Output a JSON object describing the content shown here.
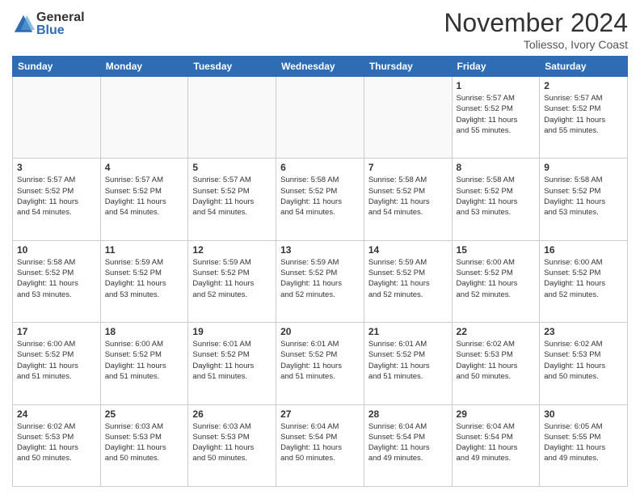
{
  "logo": {
    "general": "General",
    "blue": "Blue"
  },
  "header": {
    "month": "November 2024",
    "location": "Toliesso, Ivory Coast"
  },
  "weekdays": [
    "Sunday",
    "Monday",
    "Tuesday",
    "Wednesday",
    "Thursday",
    "Friday",
    "Saturday"
  ],
  "weeks": [
    [
      {
        "day": "",
        "info": ""
      },
      {
        "day": "",
        "info": ""
      },
      {
        "day": "",
        "info": ""
      },
      {
        "day": "",
        "info": ""
      },
      {
        "day": "",
        "info": ""
      },
      {
        "day": "1",
        "info": "Sunrise: 5:57 AM\nSunset: 5:52 PM\nDaylight: 11 hours\nand 55 minutes."
      },
      {
        "day": "2",
        "info": "Sunrise: 5:57 AM\nSunset: 5:52 PM\nDaylight: 11 hours\nand 55 minutes."
      }
    ],
    [
      {
        "day": "3",
        "info": "Sunrise: 5:57 AM\nSunset: 5:52 PM\nDaylight: 11 hours\nand 54 minutes."
      },
      {
        "day": "4",
        "info": "Sunrise: 5:57 AM\nSunset: 5:52 PM\nDaylight: 11 hours\nand 54 minutes."
      },
      {
        "day": "5",
        "info": "Sunrise: 5:57 AM\nSunset: 5:52 PM\nDaylight: 11 hours\nand 54 minutes."
      },
      {
        "day": "6",
        "info": "Sunrise: 5:58 AM\nSunset: 5:52 PM\nDaylight: 11 hours\nand 54 minutes."
      },
      {
        "day": "7",
        "info": "Sunrise: 5:58 AM\nSunset: 5:52 PM\nDaylight: 11 hours\nand 54 minutes."
      },
      {
        "day": "8",
        "info": "Sunrise: 5:58 AM\nSunset: 5:52 PM\nDaylight: 11 hours\nand 53 minutes."
      },
      {
        "day": "9",
        "info": "Sunrise: 5:58 AM\nSunset: 5:52 PM\nDaylight: 11 hours\nand 53 minutes."
      }
    ],
    [
      {
        "day": "10",
        "info": "Sunrise: 5:58 AM\nSunset: 5:52 PM\nDaylight: 11 hours\nand 53 minutes."
      },
      {
        "day": "11",
        "info": "Sunrise: 5:59 AM\nSunset: 5:52 PM\nDaylight: 11 hours\nand 53 minutes."
      },
      {
        "day": "12",
        "info": "Sunrise: 5:59 AM\nSunset: 5:52 PM\nDaylight: 11 hours\nand 52 minutes."
      },
      {
        "day": "13",
        "info": "Sunrise: 5:59 AM\nSunset: 5:52 PM\nDaylight: 11 hours\nand 52 minutes."
      },
      {
        "day": "14",
        "info": "Sunrise: 5:59 AM\nSunset: 5:52 PM\nDaylight: 11 hours\nand 52 minutes."
      },
      {
        "day": "15",
        "info": "Sunrise: 6:00 AM\nSunset: 5:52 PM\nDaylight: 11 hours\nand 52 minutes."
      },
      {
        "day": "16",
        "info": "Sunrise: 6:00 AM\nSunset: 5:52 PM\nDaylight: 11 hours\nand 52 minutes."
      }
    ],
    [
      {
        "day": "17",
        "info": "Sunrise: 6:00 AM\nSunset: 5:52 PM\nDaylight: 11 hours\nand 51 minutes."
      },
      {
        "day": "18",
        "info": "Sunrise: 6:00 AM\nSunset: 5:52 PM\nDaylight: 11 hours\nand 51 minutes."
      },
      {
        "day": "19",
        "info": "Sunrise: 6:01 AM\nSunset: 5:52 PM\nDaylight: 11 hours\nand 51 minutes."
      },
      {
        "day": "20",
        "info": "Sunrise: 6:01 AM\nSunset: 5:52 PM\nDaylight: 11 hours\nand 51 minutes."
      },
      {
        "day": "21",
        "info": "Sunrise: 6:01 AM\nSunset: 5:52 PM\nDaylight: 11 hours\nand 51 minutes."
      },
      {
        "day": "22",
        "info": "Sunrise: 6:02 AM\nSunset: 5:53 PM\nDaylight: 11 hours\nand 50 minutes."
      },
      {
        "day": "23",
        "info": "Sunrise: 6:02 AM\nSunset: 5:53 PM\nDaylight: 11 hours\nand 50 minutes."
      }
    ],
    [
      {
        "day": "24",
        "info": "Sunrise: 6:02 AM\nSunset: 5:53 PM\nDaylight: 11 hours\nand 50 minutes."
      },
      {
        "day": "25",
        "info": "Sunrise: 6:03 AM\nSunset: 5:53 PM\nDaylight: 11 hours\nand 50 minutes."
      },
      {
        "day": "26",
        "info": "Sunrise: 6:03 AM\nSunset: 5:53 PM\nDaylight: 11 hours\nand 50 minutes."
      },
      {
        "day": "27",
        "info": "Sunrise: 6:04 AM\nSunset: 5:54 PM\nDaylight: 11 hours\nand 50 minutes."
      },
      {
        "day": "28",
        "info": "Sunrise: 6:04 AM\nSunset: 5:54 PM\nDaylight: 11 hours\nand 49 minutes."
      },
      {
        "day": "29",
        "info": "Sunrise: 6:04 AM\nSunset: 5:54 PM\nDaylight: 11 hours\nand 49 minutes."
      },
      {
        "day": "30",
        "info": "Sunrise: 6:05 AM\nSunset: 5:55 PM\nDaylight: 11 hours\nand 49 minutes."
      }
    ]
  ]
}
